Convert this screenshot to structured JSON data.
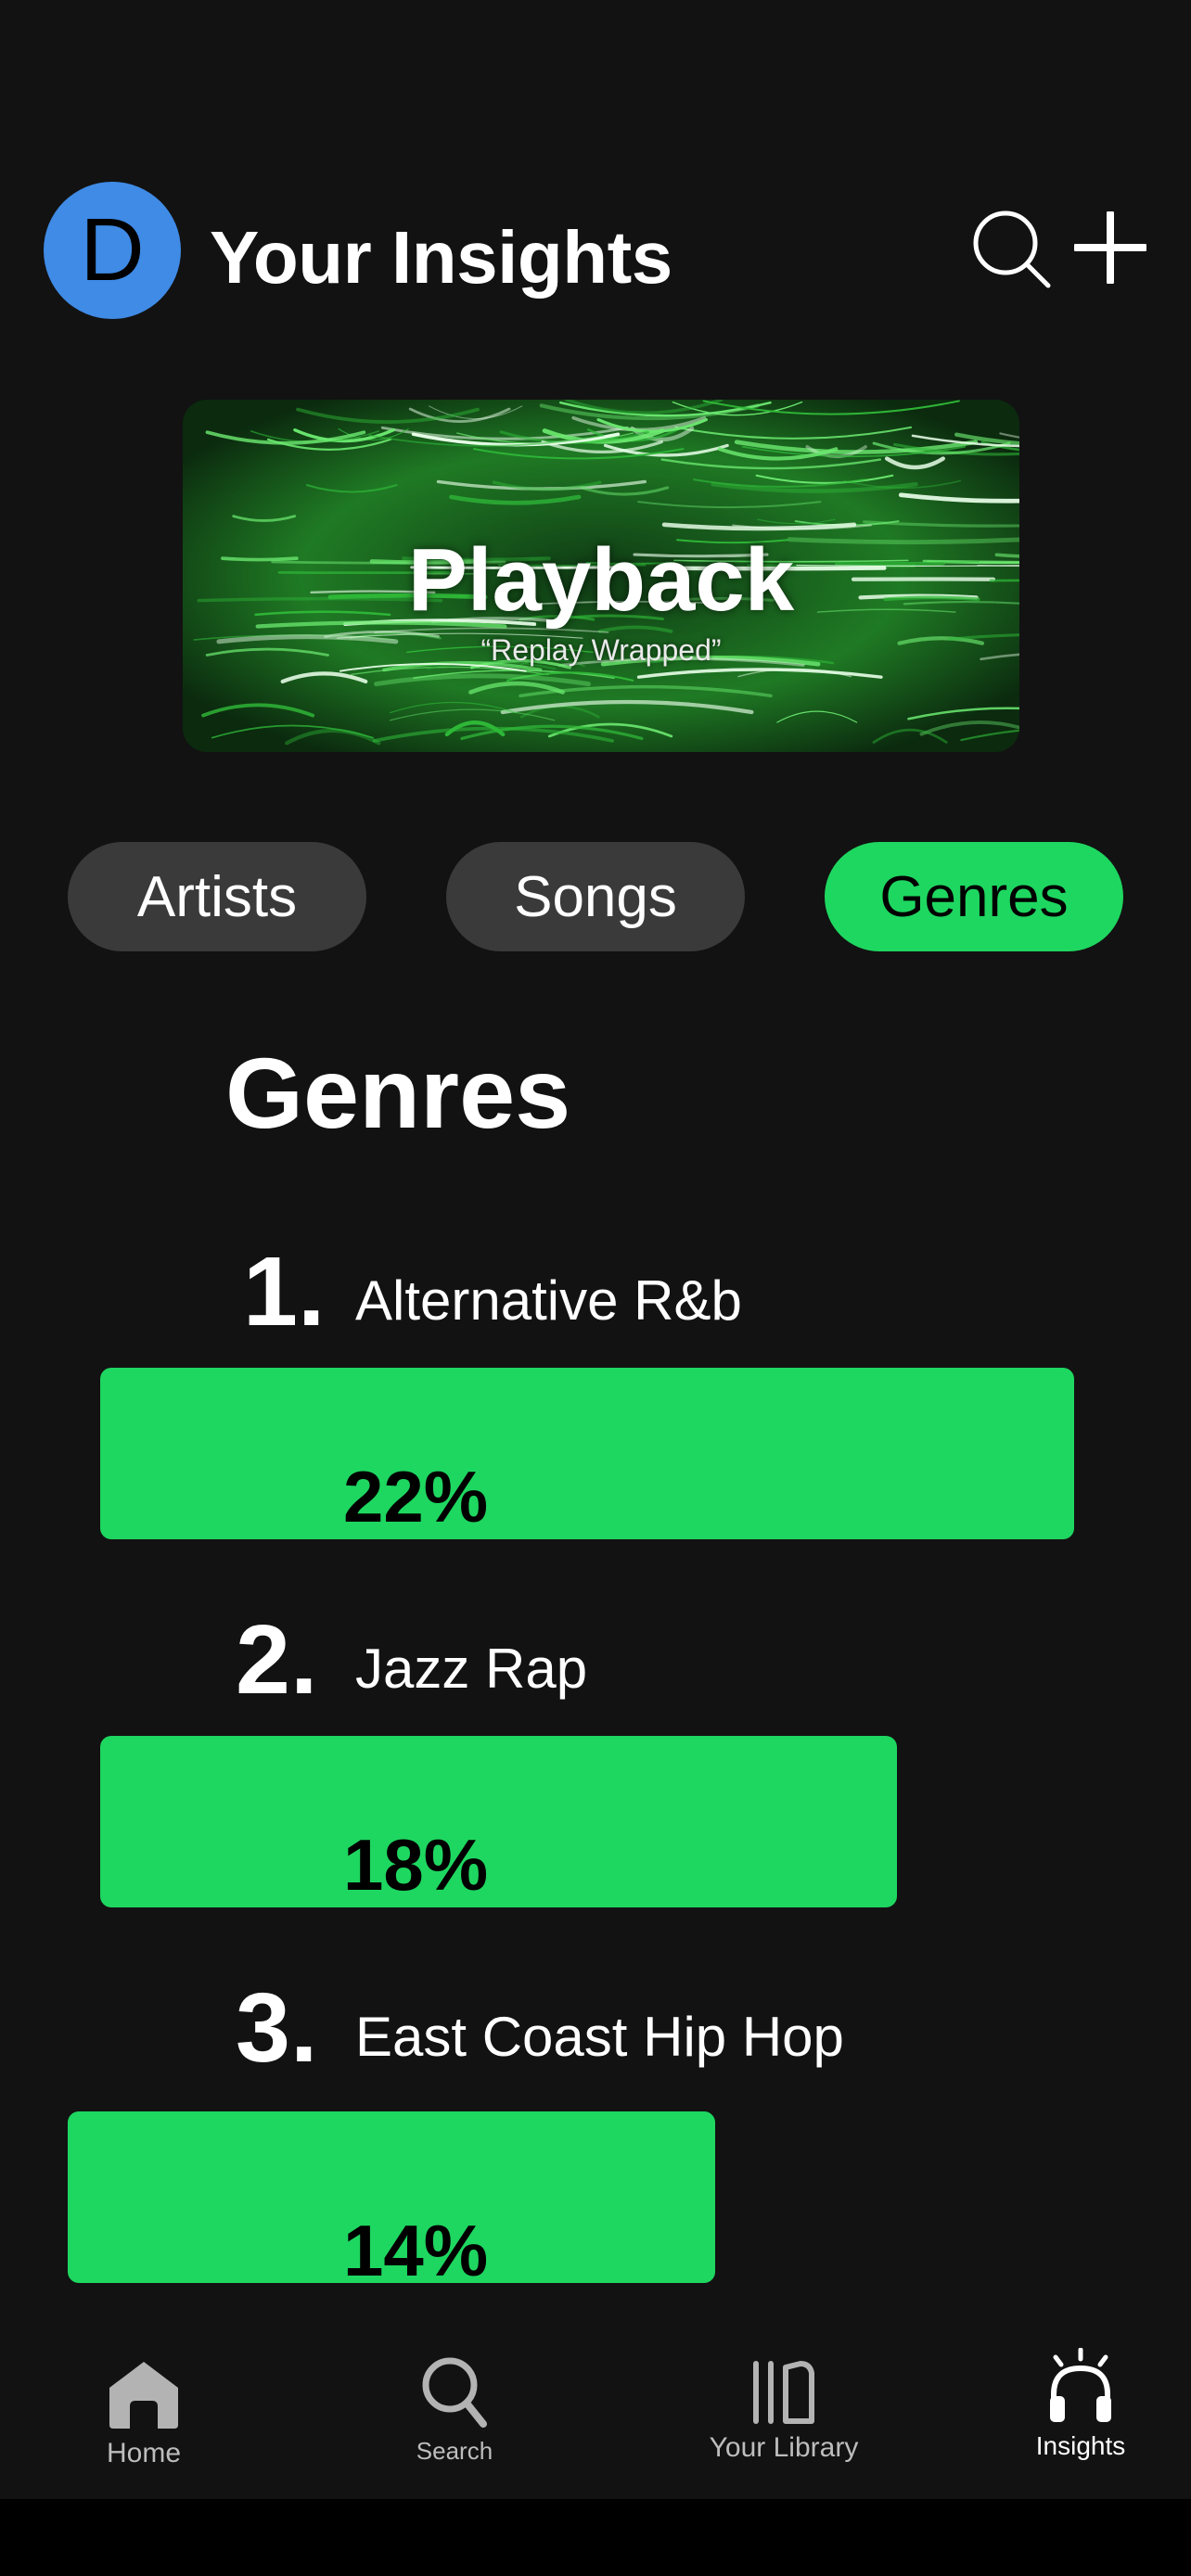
{
  "header": {
    "avatar_letter": "D",
    "title": "Your Insights",
    "icons": [
      "search-icon",
      "plus-icon"
    ]
  },
  "banner": {
    "title": "Playback",
    "subtitle": "“Replay Wrapped”"
  },
  "tabs": [
    {
      "label": "Artists",
      "active": false
    },
    {
      "label": "Songs",
      "active": false
    },
    {
      "label": "Genres",
      "active": true
    }
  ],
  "section": {
    "title": "Genres"
  },
  "genres": [
    {
      "rank": "1.",
      "name": "Alternative R&b",
      "percent_label": "22%",
      "value": 22
    },
    {
      "rank": "2.",
      "name": "Jazz Rap",
      "percent_label": "18%",
      "value": 18
    },
    {
      "rank": "3.",
      "name": "East Coast Hip Hop",
      "percent_label": "14%",
      "value": 14
    }
  ],
  "bottom_nav": [
    {
      "label": "Home",
      "icon": "home-icon",
      "active": false
    },
    {
      "label": "Search",
      "icon": "search-icon",
      "active": false
    },
    {
      "label": "Your Library",
      "icon": "library-icon",
      "active": false
    },
    {
      "label": "Insights",
      "icon": "headphones-icon",
      "active": true
    }
  ],
  "colors": {
    "background": "#121212",
    "accent": "#1ed760",
    "avatar": "#3f8be6",
    "tab_inactive": "#3a3a3a"
  }
}
